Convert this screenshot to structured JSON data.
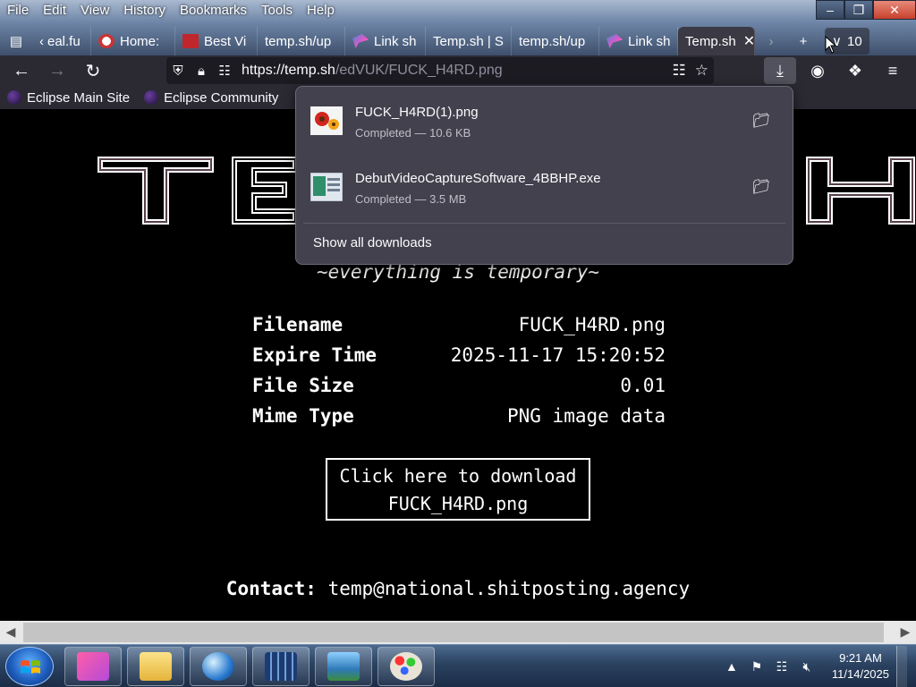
{
  "menubar": {
    "items": [
      "File",
      "Edit",
      "View",
      "History",
      "Bookmarks",
      "Tools",
      "Help"
    ]
  },
  "tabs": [
    {
      "label": "eal.fu",
      "icon": "scroll-left-icon"
    },
    {
      "label": "Home:",
      "icon": "site-avatar-icon"
    },
    {
      "label": "Best Vi",
      "icon": "site-logo-icon"
    },
    {
      "label": "temp.sh/up",
      "icon": ""
    },
    {
      "label": "Link sh",
      "icon": "bird-icon"
    },
    {
      "label": "Temp.sh | S",
      "icon": ""
    },
    {
      "label": "temp.sh/up",
      "icon": ""
    },
    {
      "label": "Link sh",
      "icon": "bird-icon"
    },
    {
      "label": "Temp.sh",
      "icon": "",
      "active": true
    }
  ],
  "tab_count": "10",
  "nav": {
    "url_host": "https://temp.sh",
    "url_path": "/edVUK/FUCK_H4RD.png"
  },
  "bookmarks": [
    {
      "label": "Eclipse Main Site"
    },
    {
      "label": "Eclipse Community"
    }
  ],
  "downloads": {
    "items": [
      {
        "name": "FUCK_H4RD(1).png",
        "status": "Completed — 10.6 KB",
        "icon": "image-file-icon"
      },
      {
        "name": "DebutVideoCaptureSoftware_4BBHP.exe",
        "status": "Completed — 3.5 MB",
        "icon": "exe-file-icon"
      }
    ],
    "show_all": "Show all downloads"
  },
  "page": {
    "logo_text": "TEMP.SH",
    "tagline": "~everything is temporary~",
    "info": [
      {
        "key": "Filename",
        "value": "FUCK_H4RD.png"
      },
      {
        "key": "Expire Time",
        "value": "2025-11-17 15:20:52"
      },
      {
        "key": "File Size",
        "value": "0.01"
      },
      {
        "key": "Mime Type",
        "value": "PNG image data"
      }
    ],
    "download_line1": "Click here to download",
    "download_line2": "FUCK_H4RD.png",
    "contact_label": "Contact:",
    "contact_value": "temp@national.shitposting.agency"
  },
  "taskbar": {
    "apps": [
      "firefox-icon",
      "file-explorer-icon",
      "browser-globe-icon",
      "video-film-icon",
      "photo-viewer-icon",
      "paint-icon"
    ],
    "time": "9:21 AM",
    "date": "11/14/2025"
  }
}
